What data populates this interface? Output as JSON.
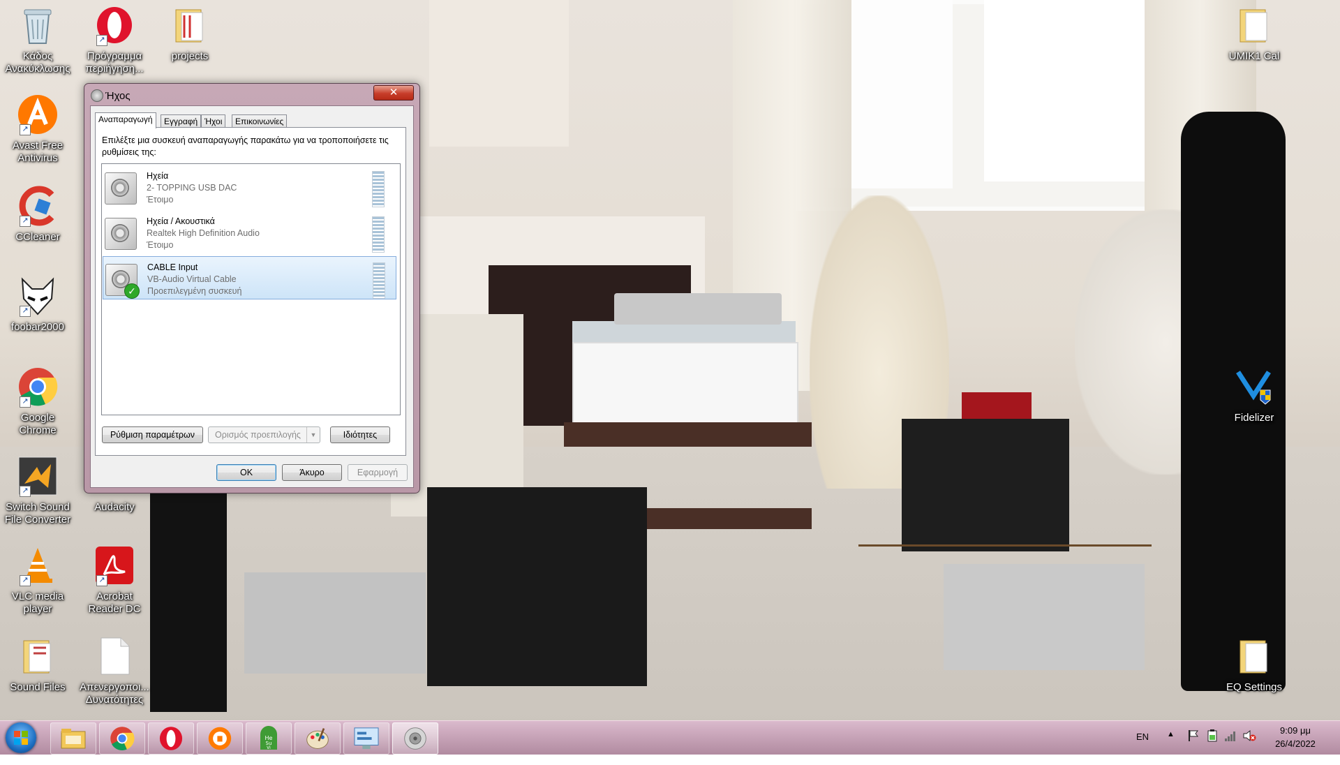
{
  "desktop": {
    "icons_left": [
      {
        "label": "Κάδος Ανακύκλωσης",
        "icon": "recycle-bin-icon"
      },
      {
        "label": "Πρόγραμμα περιήγηση...",
        "icon": "opera-icon"
      },
      {
        "label": "projects",
        "icon": "folder-icon"
      },
      {
        "label": "Avast Free Antivirus",
        "icon": "avast-icon"
      },
      {
        "label": "CCleaner",
        "icon": "ccleaner-icon"
      },
      {
        "label": "foobar2000",
        "icon": "foobar-icon"
      },
      {
        "label": "Google Chrome",
        "icon": "chrome-icon"
      },
      {
        "label": "Switch Sound File Converter",
        "icon": "switch-icon"
      },
      {
        "label": "Audacity",
        "icon": "audacity-icon"
      },
      {
        "label": "VLC media player",
        "icon": "vlc-icon"
      },
      {
        "label": "Acrobat Reader DC",
        "icon": "acrobat-icon"
      },
      {
        "label": "Sound Files",
        "icon": "folder-icon"
      },
      {
        "label": "Απενεργοποι... Δυνατότητες",
        "icon": "document-icon"
      }
    ],
    "icons_right": [
      {
        "label": "UMIK1 Cal",
        "icon": "folder-icon"
      },
      {
        "label": "Fidelizer",
        "icon": "fidelizer-icon"
      },
      {
        "label": "EQ Settings",
        "icon": "folder-icon"
      }
    ]
  },
  "dialog": {
    "title": "Ήχος",
    "close_label": "✕",
    "tabs": [
      "Αναπαραγωγή",
      "Εγγραφή",
      "Ήχοι",
      "Επικοινωνίες"
    ],
    "active_tab": 0,
    "instruction": "Επιλέξτε μια συσκευή αναπαραγωγής παρακάτω για να τροποποιήσετε τις ρυθμίσεις της:",
    "devices": [
      {
        "name": "Ηχεία",
        "description": "2- TOPPING USB DAC",
        "status": "Έτοιμο",
        "selected": false,
        "default": false
      },
      {
        "name": "Ηχεία / Ακουστικά",
        "description": "Realtek High Definition Audio",
        "status": "Έτοιμο",
        "selected": false,
        "default": false
      },
      {
        "name": "CABLE Input",
        "description": "VB-Audio Virtual Cable",
        "status": "Προεπιλεγμένη συσκευή",
        "selected": true,
        "default": true
      }
    ],
    "buttons": {
      "configure": "Ρύθμιση παραμέτρων",
      "set_default": "Ορισμός προεπιλογής",
      "properties": "Ιδιότητες",
      "ok": "OK",
      "cancel": "Άκυρο",
      "apply": "Εφαρμογή"
    }
  },
  "taskbar": {
    "pinned": [
      "explorer-icon",
      "chrome-icon",
      "opera-icon",
      "avast-secure-browser-icon",
      "hesuvi-icon",
      "paint-icon",
      "control-panel-icon",
      "sound-icon"
    ],
    "language": "EN",
    "time": "9:09 μμ",
    "date": "26/4/2022"
  },
  "colors": {
    "taskbar": "#c49bb2",
    "selection": "#cde4f8",
    "check": "#2fa82a"
  }
}
